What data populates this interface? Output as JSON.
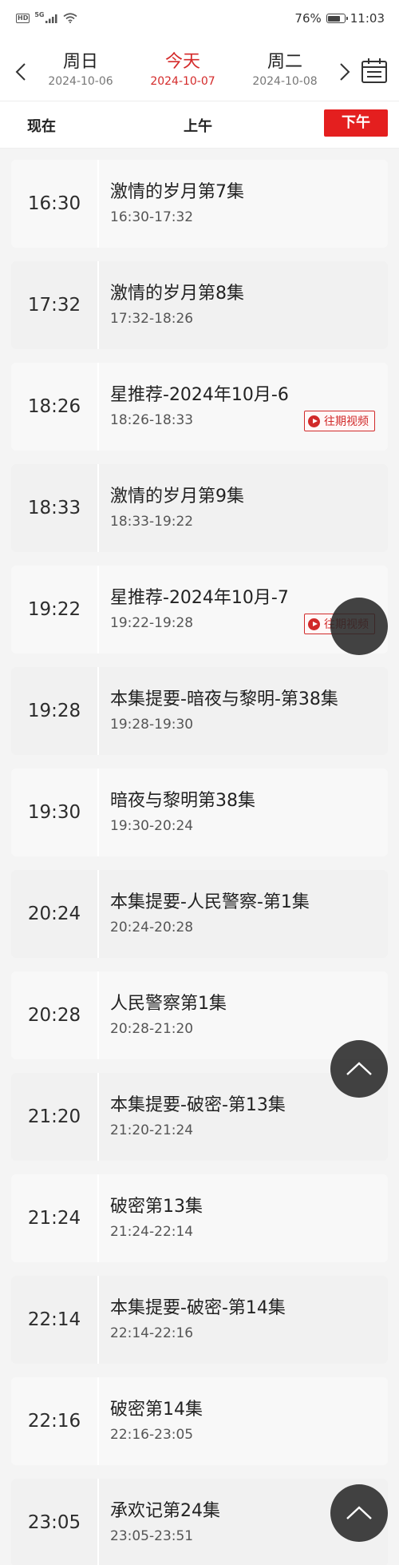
{
  "status_bar": {
    "hd": "HD",
    "net": "5G",
    "battery": "76%",
    "battery_level": 0.76,
    "time": "11:03"
  },
  "date_nav": {
    "days": [
      {
        "name": "周日",
        "date": "2024-10-06"
      },
      {
        "name": "今天",
        "date": "2024-10-07"
      },
      {
        "name": "周二",
        "date": "2024-10-08"
      }
    ]
  },
  "periods": {
    "now": "现在",
    "am": "上午",
    "pm": "下午"
  },
  "schedule": [
    {
      "time": "16:30",
      "title": "激情的岁月第7集",
      "range": "16:30-17:32"
    },
    {
      "time": "17:32",
      "title": "激情的岁月第8集",
      "range": "17:32-18:26"
    },
    {
      "time": "18:26",
      "title": "星推荐-2024年10月-6",
      "range": "18:26-18:33",
      "badge": "往期视频"
    },
    {
      "time": "18:33",
      "title": "激情的岁月第9集",
      "range": "18:33-19:22"
    },
    {
      "time": "19:22",
      "title": "星推荐-2024年10月-7",
      "range": "19:22-19:28",
      "badge": "往期视频"
    },
    {
      "time": "19:28",
      "title": "本集提要-暗夜与黎明-第38集",
      "range": "19:28-19:30"
    },
    {
      "time": "19:30",
      "title": "暗夜与黎明第38集",
      "range": "19:30-20:24"
    },
    {
      "time": "20:24",
      "title": "本集提要-人民警察-第1集",
      "range": "20:24-20:28"
    },
    {
      "time": "20:28",
      "title": "人民警察第1集",
      "range": "20:28-21:20"
    },
    {
      "time": "21:20",
      "title": "本集提要-破密-第13集",
      "range": "21:20-21:24"
    },
    {
      "time": "21:24",
      "title": "破密第13集",
      "range": "21:24-22:14"
    },
    {
      "time": "22:14",
      "title": "本集提要-破密-第14集",
      "range": "22:14-22:16"
    },
    {
      "time": "22:16",
      "title": "破密第14集",
      "range": "22:16-23:05"
    },
    {
      "time": "23:05",
      "title": "承欢记第24集",
      "range": "23:05-23:51"
    }
  ]
}
